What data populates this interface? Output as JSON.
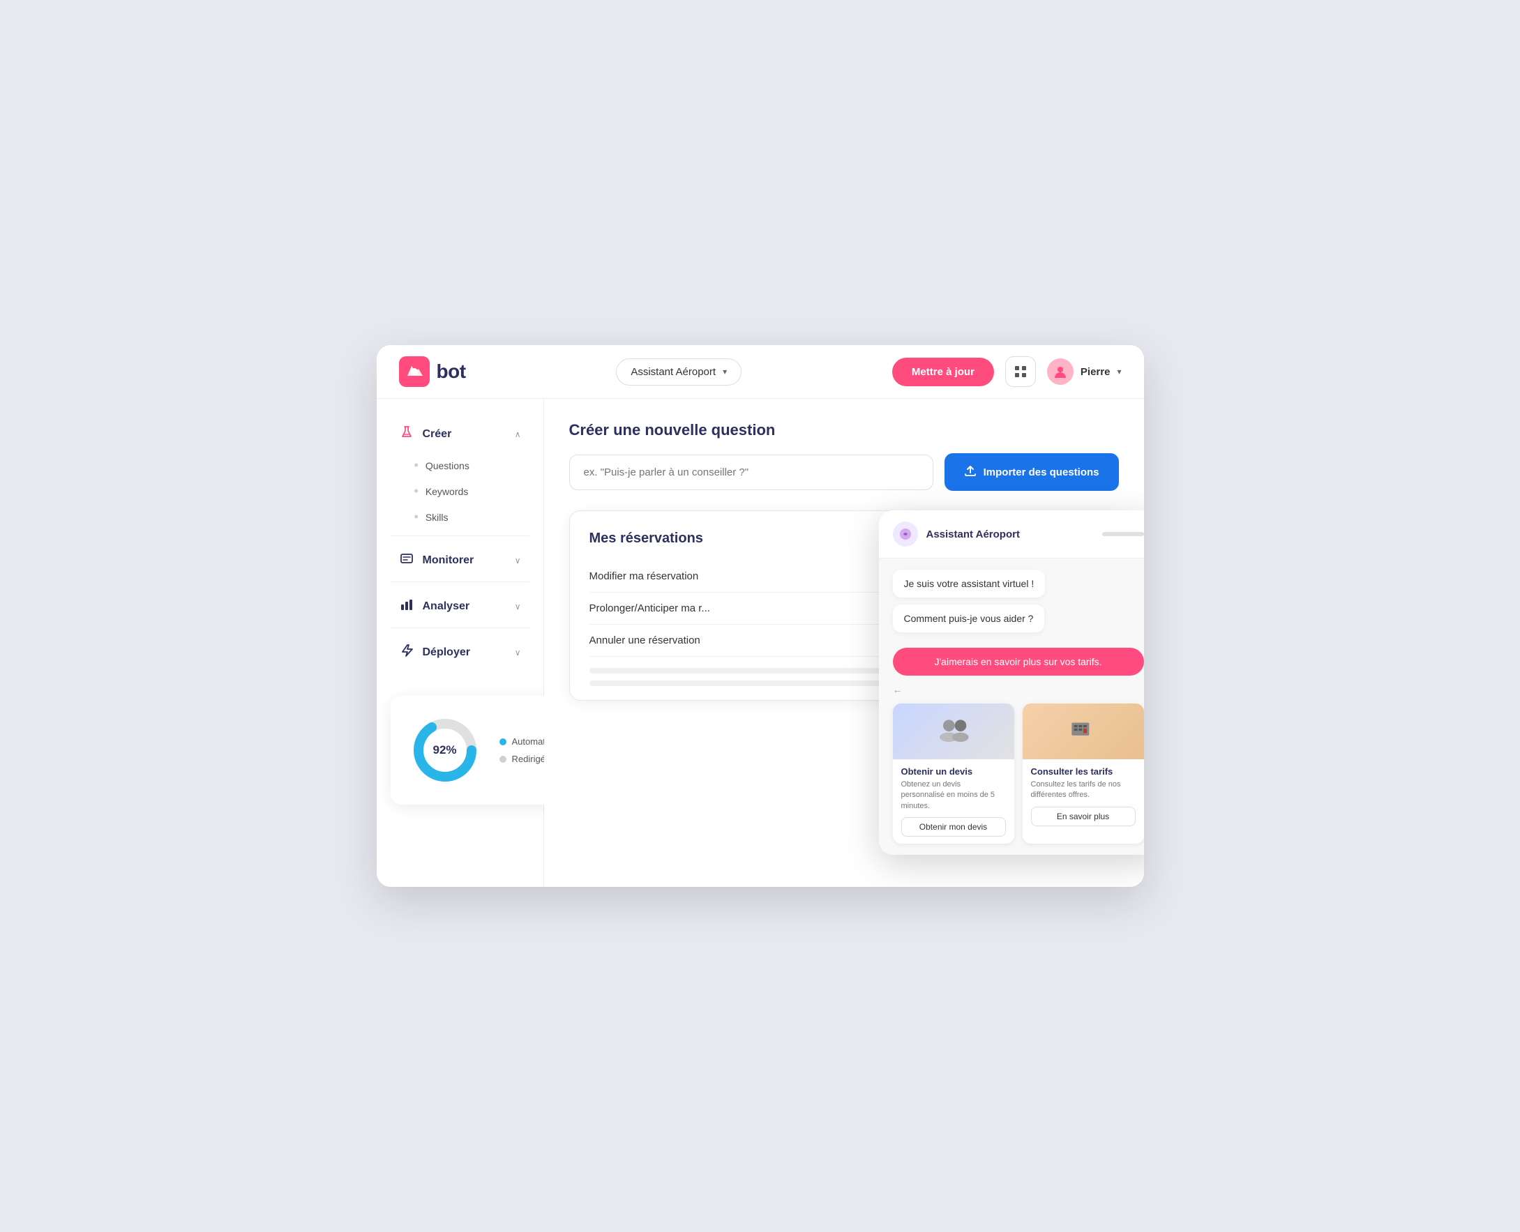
{
  "header": {
    "logo_text": "bot",
    "assistant_dropdown": "Assistant Aéroport",
    "update_button": "Mettre à jour",
    "user_name": "Pierre"
  },
  "sidebar": {
    "sections": [
      {
        "id": "creer",
        "label": "Créer",
        "icon": "🧪",
        "active": true,
        "expanded": true,
        "sub_items": [
          {
            "label": "Questions"
          },
          {
            "label": "Keywords"
          },
          {
            "label": "Skills"
          }
        ]
      },
      {
        "id": "monitorer",
        "label": "Monitorer",
        "icon": "💬",
        "active": false,
        "expanded": false,
        "sub_items": []
      },
      {
        "id": "analyser",
        "label": "Analyser",
        "icon": "📊",
        "active": false,
        "expanded": false,
        "sub_items": []
      },
      {
        "id": "deployer",
        "label": "Déployer",
        "icon": "⚡",
        "active": false,
        "expanded": false,
        "sub_items": []
      }
    ]
  },
  "content": {
    "page_title": "Créer une nouvelle question",
    "question_input_placeholder": "ex. \"Puis-je parler à un conseiller ?\"",
    "import_button": "Importer des questions",
    "card_title": "Mes réservations",
    "question_items": [
      {
        "text": "Modifier ma réservation"
      },
      {
        "text": "Prolonger/Anticiper ma r..."
      },
      {
        "text": "Annuler une réservation"
      }
    ]
  },
  "analytics": {
    "percentage": "92%",
    "legend": [
      {
        "label": "Automatisé par le chatbot",
        "color": "#29b5e8"
      },
      {
        "label": "Redirigé vers un agent",
        "color": "#d0d0d0"
      }
    ]
  },
  "chat_widget": {
    "bot_name": "Assistant Aéroport",
    "messages": [
      {
        "type": "bot",
        "text": "Je suis votre assistant virtuel !"
      },
      {
        "type": "bot",
        "text": "Comment puis-je vous aider ?"
      }
    ],
    "user_message": "J'aimerais en savoir plus sur vos tarifs.",
    "cards": [
      {
        "title": "Obtenir un devis",
        "description": "Obtenez un devis personnalisé en moins de 5 minutes.",
        "button_label": "Obtenir mon devis",
        "emoji": "👥"
      },
      {
        "title": "Consulter les tarifs",
        "description": "Consultez les tarifs de nos différentes offres.",
        "button_label": "En savoir plus",
        "emoji": "⌨️"
      }
    ]
  }
}
